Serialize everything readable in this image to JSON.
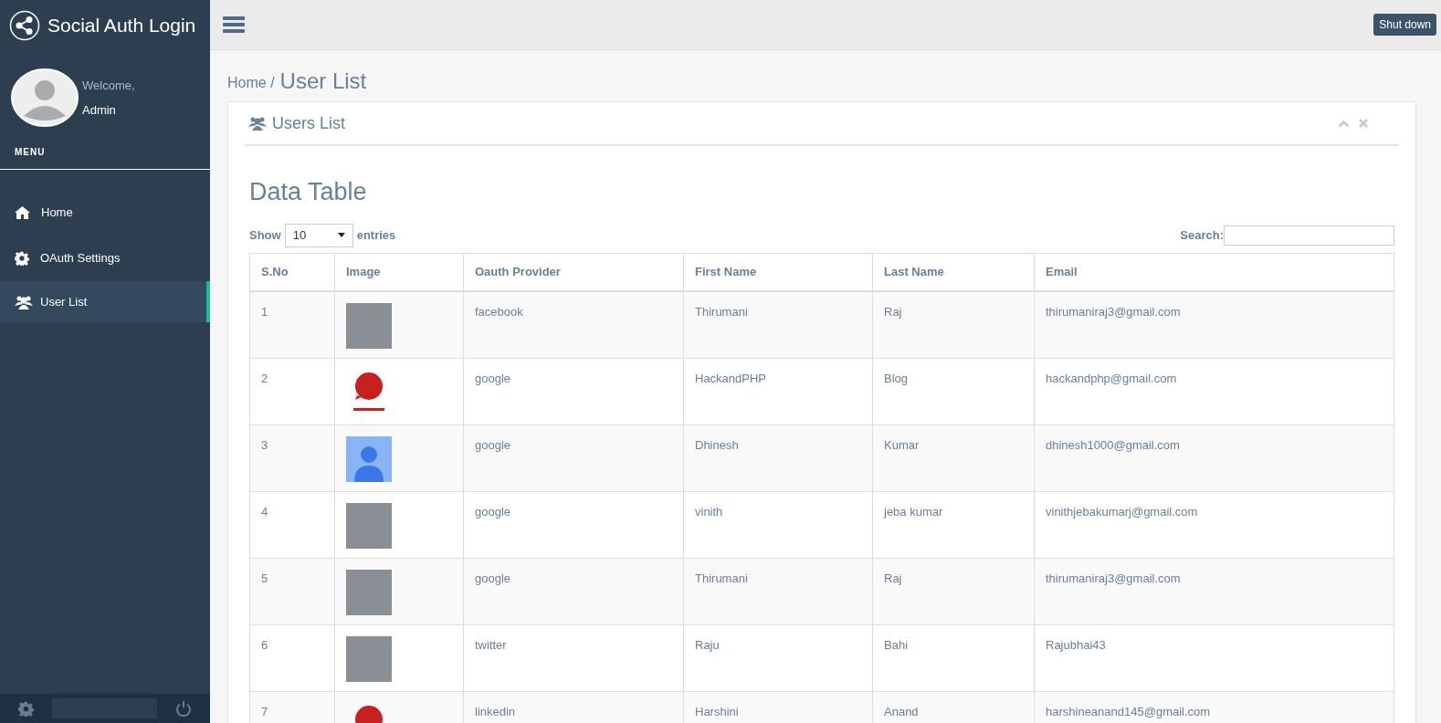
{
  "brand": {
    "title": "Social Auth Login"
  },
  "user": {
    "greeting": "Welcome,",
    "name": "Admin"
  },
  "menu_heading": "MENU",
  "sidebar": {
    "items": [
      {
        "label": "Home",
        "selected": false
      },
      {
        "label": "OAuth Settings",
        "selected": false
      },
      {
        "label": "User List",
        "selected": true
      }
    ]
  },
  "topbar": {
    "button": "Shut down"
  },
  "breadcrumb": {
    "parent": "Home /",
    "current": "User List"
  },
  "panel": {
    "title": "Users List"
  },
  "section_title": "Data Table",
  "length": {
    "before": "Show",
    "value": "10",
    "after": "entries"
  },
  "search": {
    "label": "Search:"
  },
  "table": {
    "columns": [
      "S.No",
      "Image",
      "Oauth Provider",
      "First Name",
      "Last Name",
      "Email"
    ],
    "rows": [
      {
        "sno": "1",
        "kind": "photo",
        "provider": "facebook",
        "first": "Thirumani",
        "last": "Raj",
        "email": "thirumaniraj3@gmail.com"
      },
      {
        "sno": "2",
        "kind": "logo",
        "provider": "google",
        "first": "HackandPHP",
        "last": "Blog",
        "email": "hackandphp@gmail.com"
      },
      {
        "sno": "3",
        "kind": "avatar",
        "provider": "google",
        "first": "Dhinesh",
        "last": "Kumar",
        "email": "dhinesh1000@gmail.com"
      },
      {
        "sno": "4",
        "kind": "photo",
        "provider": "google",
        "first": "vinith",
        "last": "jeba kumar",
        "email": "vinithjebakumarj@gmail.com"
      },
      {
        "sno": "5",
        "kind": "photo",
        "provider": "google",
        "first": "Thirumani",
        "last": "Raj",
        "email": "thirumaniraj3@gmail.com"
      },
      {
        "sno": "6",
        "kind": "photo",
        "provider": "twitter",
        "first": "Raju",
        "last": "Bahi",
        "email": "Rajubhai43"
      },
      {
        "sno": "7",
        "kind": "logo",
        "provider": "linkedin",
        "first": "Harshini",
        "last": "Anand",
        "email": "harshineanand145@gmail.com"
      }
    ]
  }
}
